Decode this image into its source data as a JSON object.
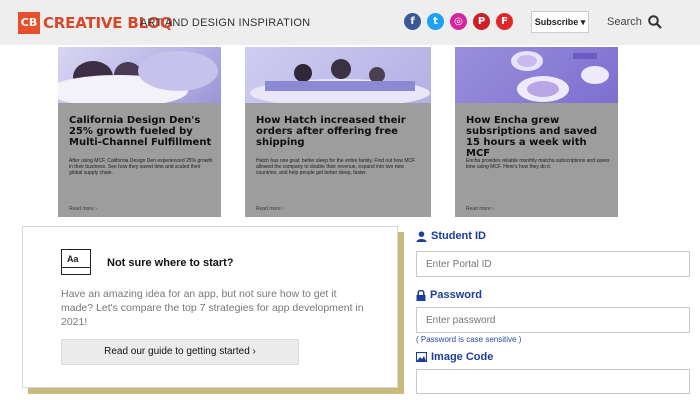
{
  "header": {
    "logo_mark": "CB",
    "logo_text": "CREATIVE BLOQ",
    "tagline": "ART AND DESIGN INSPIRATION",
    "subscribe_label": "Subscribe",
    "search_label": "Search",
    "social": [
      {
        "icon": "facebook-icon",
        "glyph": "f",
        "color": "#3b5998"
      },
      {
        "icon": "twitter-icon",
        "glyph": "t",
        "color": "#1da1f2"
      },
      {
        "icon": "instagram-icon",
        "glyph": "◎",
        "color": "#d6249f"
      },
      {
        "icon": "pinterest-icon",
        "glyph": "P",
        "color": "#cb2027"
      },
      {
        "icon": "flipboard-icon",
        "glyph": "F",
        "color": "#e12828"
      }
    ]
  },
  "cards": [
    {
      "title": "California Design Den's 25% growth fueled by Multi-Channel Fulfillment",
      "body": "After using MCF, California Design Den experienced 25% growth in their business. See how they saved time and scaled their global supply chain.",
      "more": "Read more ›"
    },
    {
      "title": "How Hatch increased their orders after offering free shipping",
      "body": "Hatch has one goal: better sleep for the entire family. Find out how MCF allowed the company to double their revenue, expand into two new countries, and help people get better sleep, faster.",
      "more": "Read more ›"
    },
    {
      "title": "How Encha grew subsriptions and saved 15 hours a week with MCF",
      "body": "Encha provides reliable monthly matcha subscriptions and saves time using MCF. Here's how they do it.",
      "more": "Read more ›"
    }
  ],
  "promo": {
    "icon_text": "Aa",
    "title": "Not sure where to start?",
    "text": "Have an amazing idea for an app, but not sure how to get it made? Let's compare the top 7 strategies for app development in 2021!",
    "button": "Read our guide to getting started ›"
  },
  "form": {
    "student_id_label": "Student ID",
    "student_id_placeholder": "Enter Portal ID",
    "password_label": "Password",
    "password_placeholder": "Enter password",
    "password_hint": "( Password is case sensitive )",
    "image_code_label": "Image Code",
    "image_code_placeholder": ""
  },
  "colors": {
    "brand": "#e8502b",
    "form_label": "#1c3c9e",
    "card_bg": "#9d9d9d",
    "promo_shadow": "#c9b97c"
  }
}
